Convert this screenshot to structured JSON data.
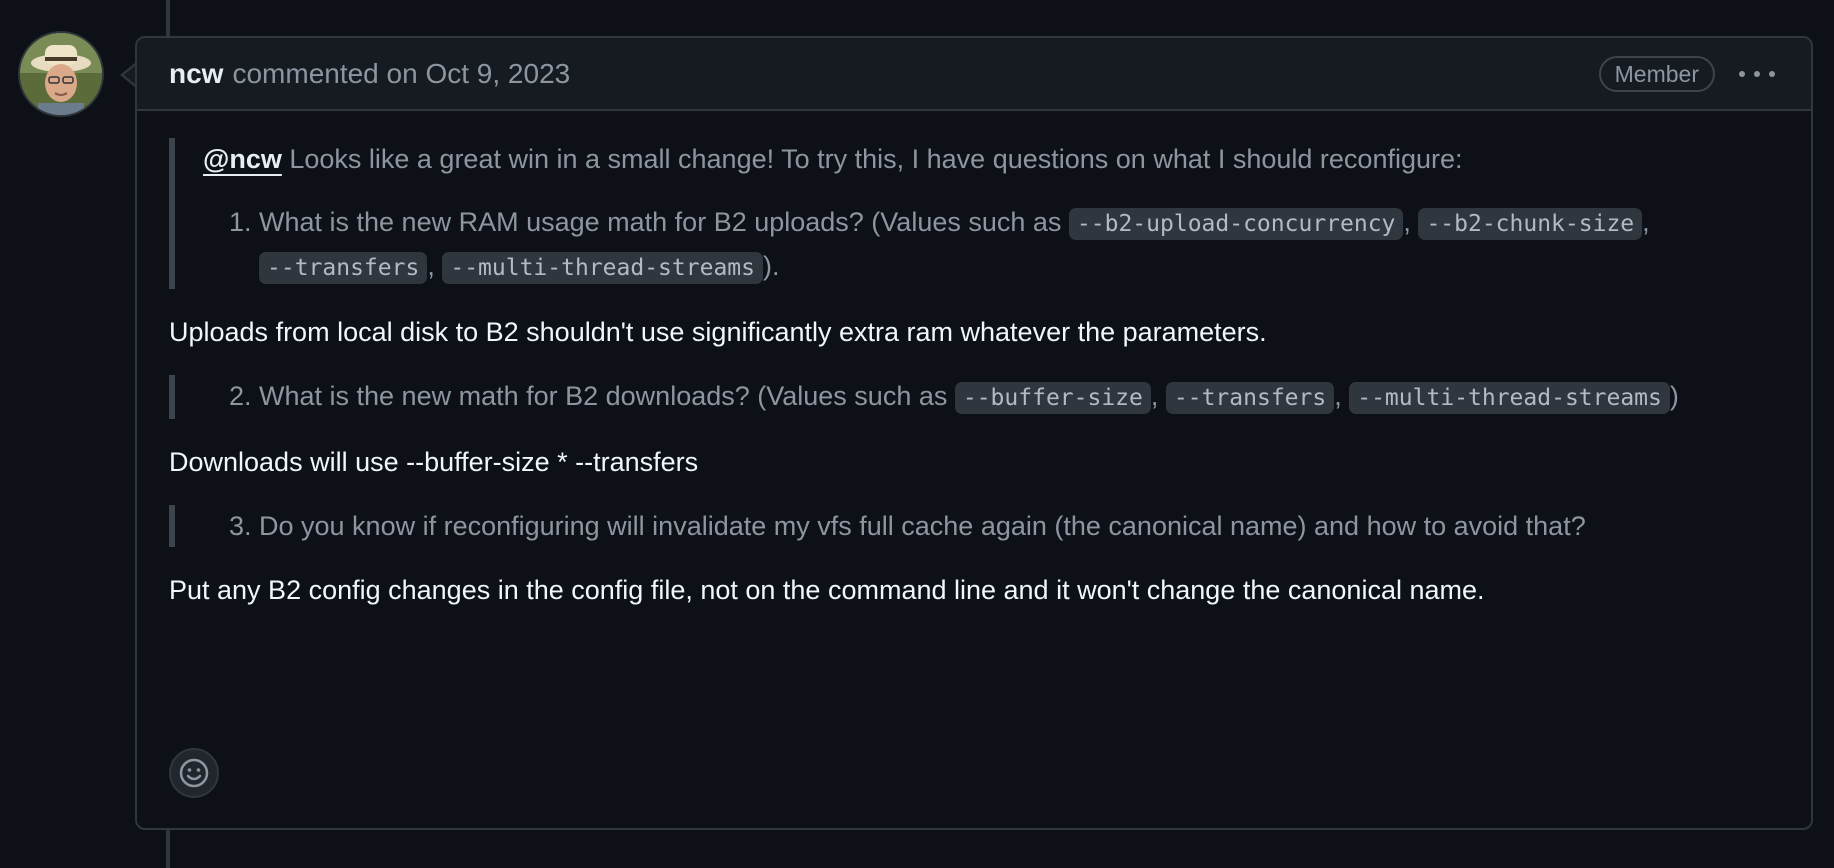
{
  "comment": {
    "author": "ncw",
    "meta": "commented on Oct 9, 2023",
    "badge": "Member",
    "more_icon": "kebab-horizontal-icon",
    "avatar_icon": "avatar-photo",
    "quote1": {
      "mention": "@ncw",
      "intro": " Looks like a great win in a small change! To try this, I have questions on what I should reconfigure:",
      "item_text_a": "What is the new RAM usage math for B2 uploads? (Values such as ",
      "code1": "--b2-upload-concurrency",
      "sep1": ", ",
      "code2": "--b2-chunk-size",
      "sep2": ", ",
      "code3": "--transfers",
      "sep3": ", ",
      "code4": "--multi-thread-streams",
      "item_text_b": ")."
    },
    "answer1": "Uploads from local disk to B2 shouldn't use significantly extra ram whatever the parameters.",
    "quote2": {
      "item_text_a": "What is the new math for B2 downloads? (Values such as ",
      "code1": "--buffer-size",
      "sep1": ", ",
      "code2": "--transfers",
      "sep2": ", ",
      "code3": "--multi-thread-streams",
      "item_text_b": ")"
    },
    "answer2": "Downloads will use --buffer-size * --transfers",
    "quote3": {
      "item_text": "Do you know if reconfiguring will invalidate my vfs full cache again (the canonical name) and how to avoid that?"
    },
    "answer3": "Put any B2 config changes in the config file, not on the command line and it won't change the canonical name.",
    "reaction_icon": "smiley-icon"
  }
}
